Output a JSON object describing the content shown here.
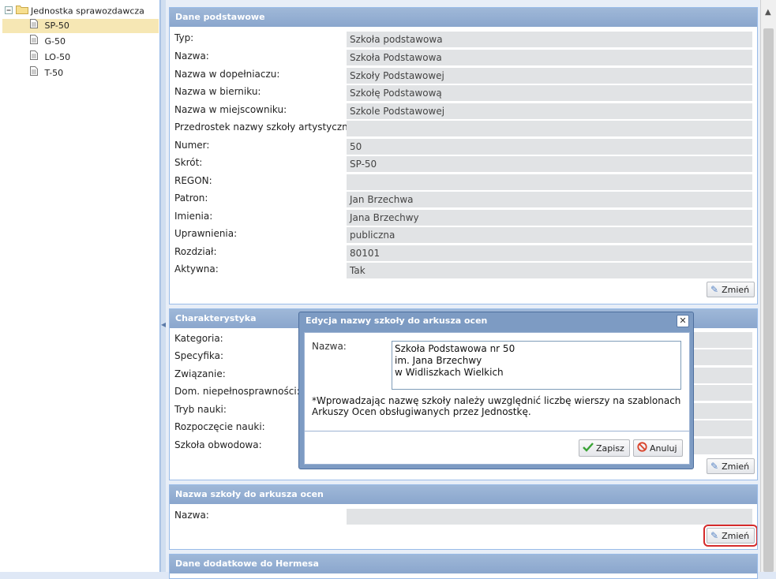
{
  "tree": {
    "root": "Jednostka sprawozdawcza",
    "items": [
      "SP-50",
      "G-50",
      "LO-50",
      "T-50"
    ],
    "selected": "SP-50"
  },
  "dane_podstawowe": {
    "title": "Dane podstawowe",
    "rows": [
      {
        "label": "Typ:",
        "value": "Szkoła podstawowa"
      },
      {
        "label": "Nazwa:",
        "value": "Szkoła Podstawowa"
      },
      {
        "label": "Nazwa w dopełniaczu:",
        "value": "Szkoły Podstawowej"
      },
      {
        "label": "Nazwa w bierniku:",
        "value": "Szkołę Podstawową"
      },
      {
        "label": "Nazwa w miejscowniku:",
        "value": "Szkole Podstawowej"
      },
      {
        "label": "Przedrostek nazwy szkoły artystycznej:",
        "value": ""
      },
      {
        "label": "Numer:",
        "value": "50"
      },
      {
        "label": "Skrót:",
        "value": "SP-50"
      },
      {
        "label": "REGON:",
        "value": ""
      },
      {
        "label": "Patron:",
        "value": "Jan Brzechwa"
      },
      {
        "label": "Imienia:",
        "value": "Jana Brzechwy"
      },
      {
        "label": "Uprawnienia:",
        "value": "publiczna"
      },
      {
        "label": "Rozdział:",
        "value": "80101"
      },
      {
        "label": "Aktywna:",
        "value": "Tak"
      }
    ],
    "button": "Zmień"
  },
  "charakterystyka": {
    "title": "Charakterystyka",
    "rows": [
      {
        "label": "Kategoria:",
        "value": ""
      },
      {
        "label": "Specyfika:",
        "value": ""
      },
      {
        "label": "Związanie:",
        "value": ""
      },
      {
        "label": "Dom. niepełnosprawności:",
        "value": ""
      },
      {
        "label": "Tryb nauki:",
        "value": ""
      },
      {
        "label": "Rozpoczęcie nauki:",
        "value": ""
      },
      {
        "label": "Szkoła obwodowa:",
        "value": ""
      }
    ],
    "button": "Zmień"
  },
  "nazwa_arkusz": {
    "title": "Nazwa szkoły do arkusza ocen",
    "rows": [
      {
        "label": "Nazwa:",
        "value": ""
      }
    ],
    "button": "Zmień"
  },
  "hermes": {
    "title": "Dane dodatkowe do Hermesa"
  },
  "modal": {
    "title": "Edycja nazwy szkoły do arkusza ocen",
    "field_label": "Nazwa:",
    "field_value": "Szkoła Podstawowa nr 50\nim. Jana Brzechwy\nw Widliszkach Wielkich",
    "note": "*Wprowadzając nazwę szkoły należy uwzględnić liczbę wierszy na szablonach Arkuszy Ocen obsługiwanych przez Jednostkę.",
    "save": "Zapisz",
    "cancel": "Anuluj"
  },
  "colors": {
    "accent": "#99bbe8",
    "selected": "#f6e7b4",
    "highlight": "#d52b2b"
  },
  "icons": [
    "folder-icon",
    "document-icon",
    "pencil-icon",
    "check-icon",
    "cancel-icon",
    "close-icon",
    "scroll-up-icon"
  ]
}
